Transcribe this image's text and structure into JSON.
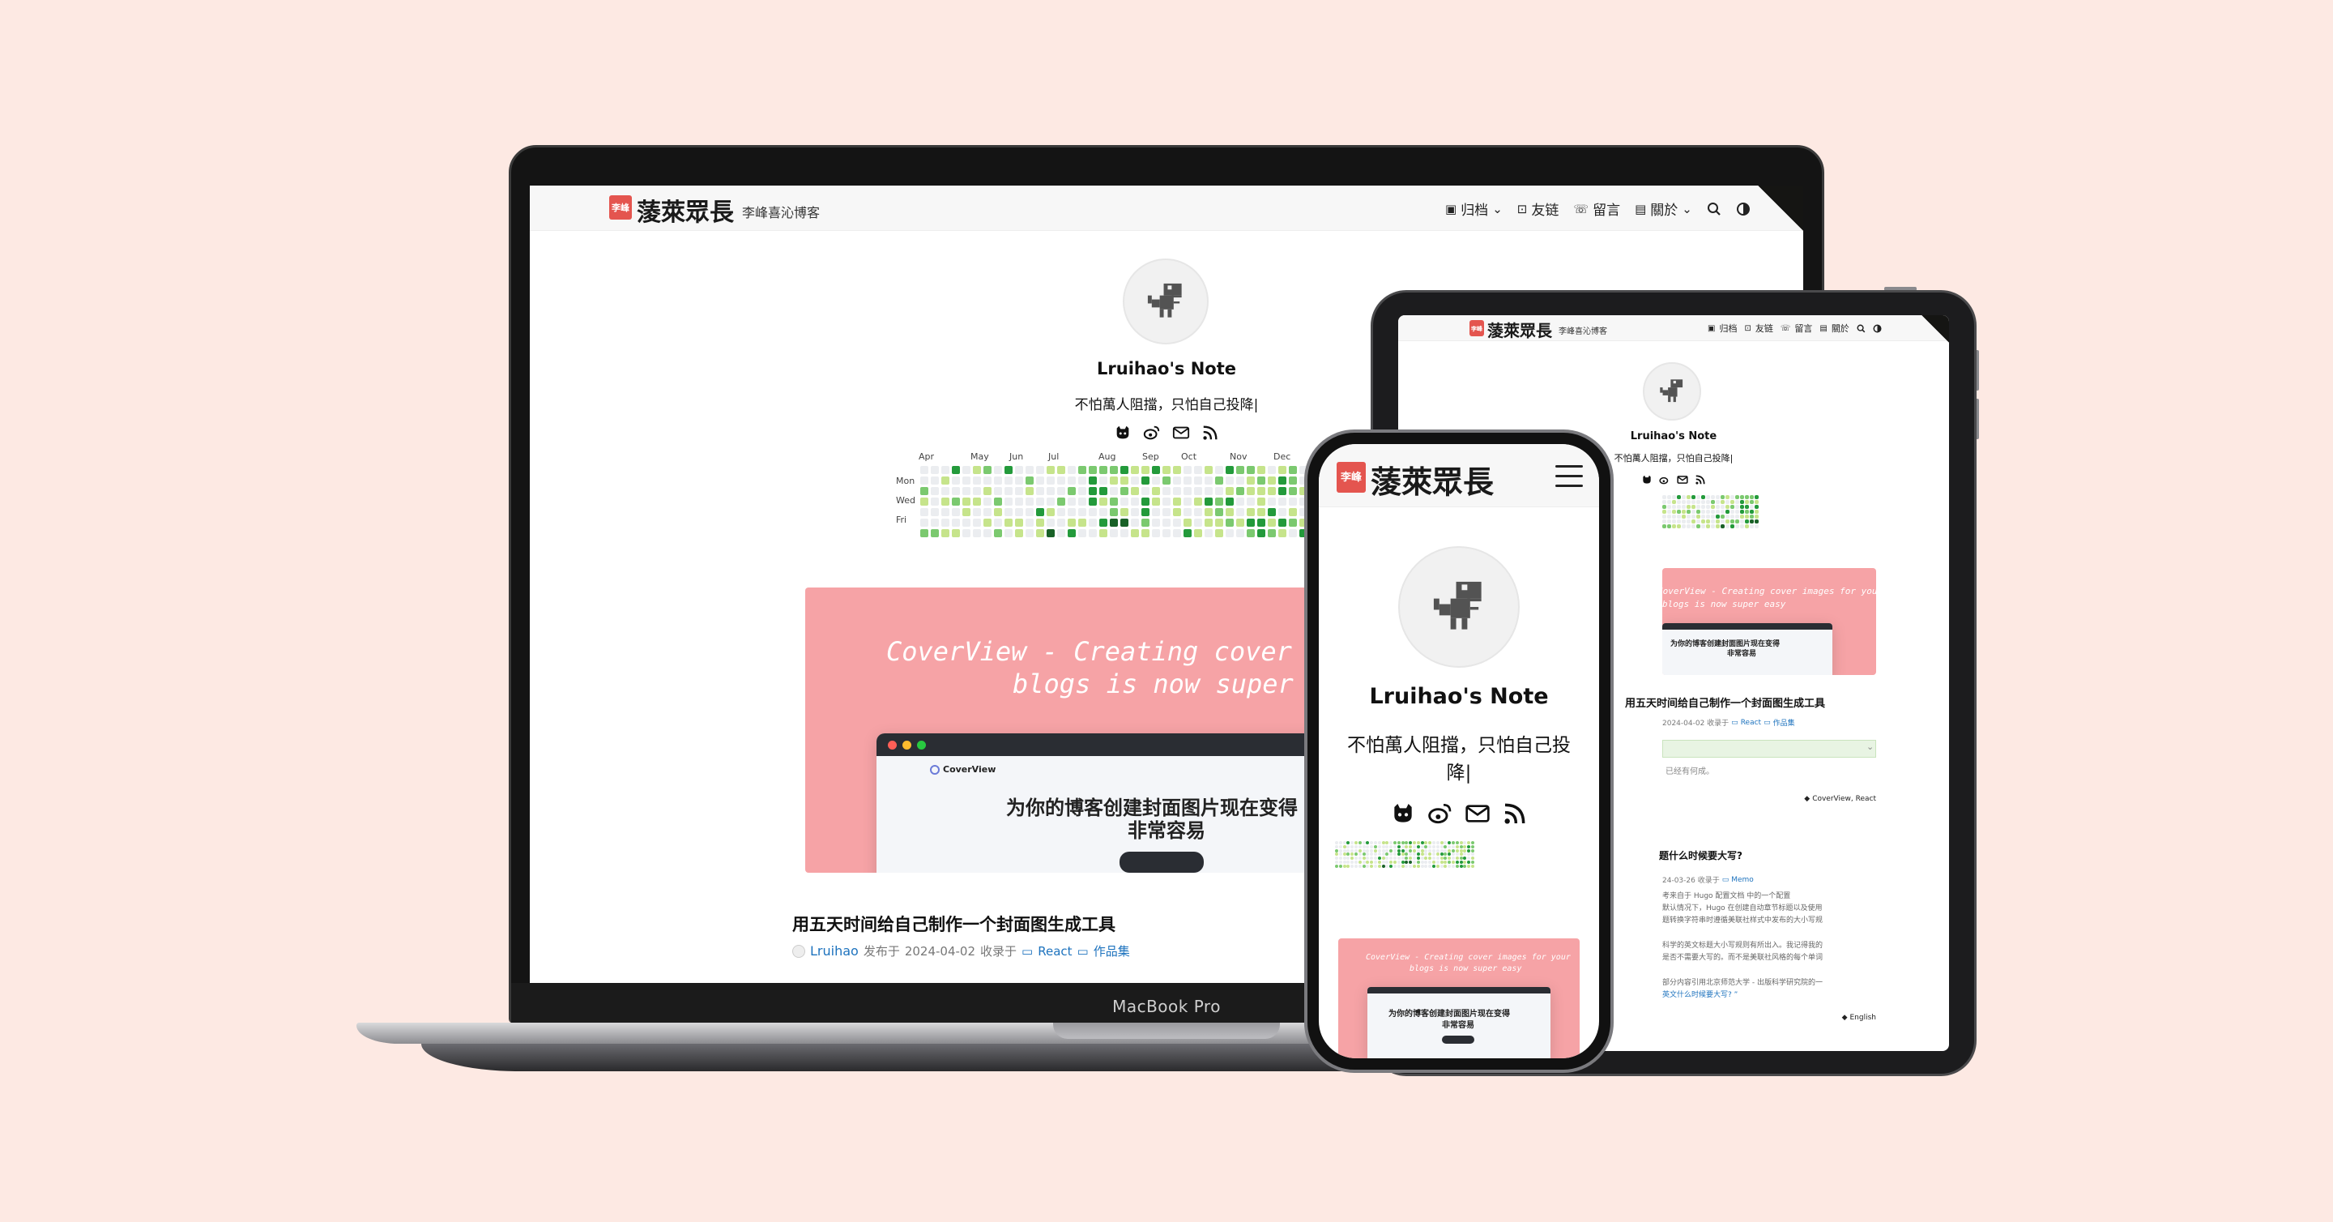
{
  "site": {
    "brand_title": "蔆萊眾長",
    "brand_subtitle": "李峰喜沁博客",
    "seal_text": "李峰",
    "author_name": "Lruihao's Note",
    "tagline": "不怕萬人阻擋，只怕自己投降|",
    "tagline_phone_line1": "不怕萬人阻擋，只怕自己投",
    "tagline_phone_line2": "降|"
  },
  "nav": {
    "archive": "归档",
    "friends": "友链",
    "guestbook": "留言",
    "about": "關於"
  },
  "heatmap": {
    "months": [
      "Apr",
      "May",
      "Jun",
      "Jul",
      "Aug",
      "Sep",
      "Oct",
      "Nov",
      "Dec"
    ],
    "days": [
      "Mon",
      "Wed",
      "Fri"
    ],
    "colors": [
      "#ebedf0",
      "#c6e48b",
      "#7bc96f",
      "#239a3b",
      "#196127"
    ]
  },
  "post": {
    "cover_title_line1": "CoverView - Creating cover images for your",
    "cover_title_line2": "blogs is now super easy",
    "mock_brand": "CoverView",
    "mock_heading_line1": "为你的博客创建封面图片现在变得",
    "mock_heading_line2": "非常容易",
    "title": "用五天时间给自己制作一个封面图生成工具",
    "author": "Lruihao",
    "published_prefix": "发布于",
    "date": "2024-04-02",
    "collected_in": "收录于",
    "category1": "React",
    "category2": "作品集"
  },
  "ipad": {
    "post1_title": "用五天时间给自己制作一个封面图生成工具",
    "post1_meta": "2024-04-02 收录于",
    "post1_cat1": "React",
    "post1_cat2": "作品集",
    "notice": "已经有何成。",
    "tags1": "CoverView, React",
    "post2_title": "题什么时候要大写?",
    "post2_meta": "24-03-26 收录于",
    "post2_cat": "Memo",
    "summary_link1": "Hugo 配置文档",
    "summary_line1": "考来自于 Hugo 配置文档 中的一个配置",
    "summary_line2": "默认情况下，Hugo 在创建自动章节标题以及使用",
    "summary_line3": "题转换字符串时遵循美联社样式中发布的大小写规",
    "summary_line4": "科学的英文标题大小写规则有所出入。我记得我的",
    "summary_line5": "是否不需要大写的。而不是美联社风格的每个单词",
    "summary_line6": "部分内容引用北京师范大学 - 出版科学研究院的一",
    "summary_line7": "英文什么时候要大写? ”",
    "summary_link2": "英文什么时候要大写? ”",
    "tags2": "English"
  },
  "macbook": {
    "label": "MacBook Pro"
  },
  "colors": {
    "background": "#fde9e3",
    "cover_pink": "#f6a3a6",
    "seal_red": "#e4554f",
    "link_blue": "#1e73be"
  }
}
